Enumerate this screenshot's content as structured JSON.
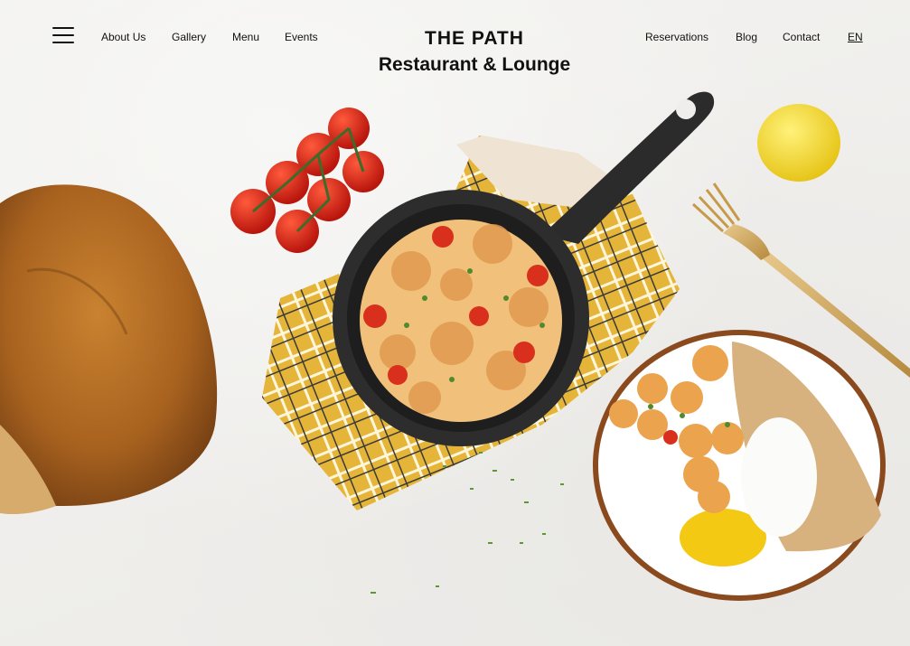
{
  "nav": {
    "menu_icon": "hamburger-menu-icon",
    "left_links": [
      "About Us",
      "Gallery",
      "Menu",
      "Events"
    ],
    "right_links": [
      "Reservations",
      "Blog",
      "Contact"
    ],
    "language": "EN"
  },
  "brand": {
    "title": "THE PATH",
    "subtitle": "Restaurant & Lounge"
  },
  "hero": {
    "image": "food-photo-pasta-pan-bread-tomatoes-lemon-fork-plate"
  },
  "colors": {
    "background": "#efeeec",
    "text": "#111111",
    "accent": "#e0b33a"
  }
}
